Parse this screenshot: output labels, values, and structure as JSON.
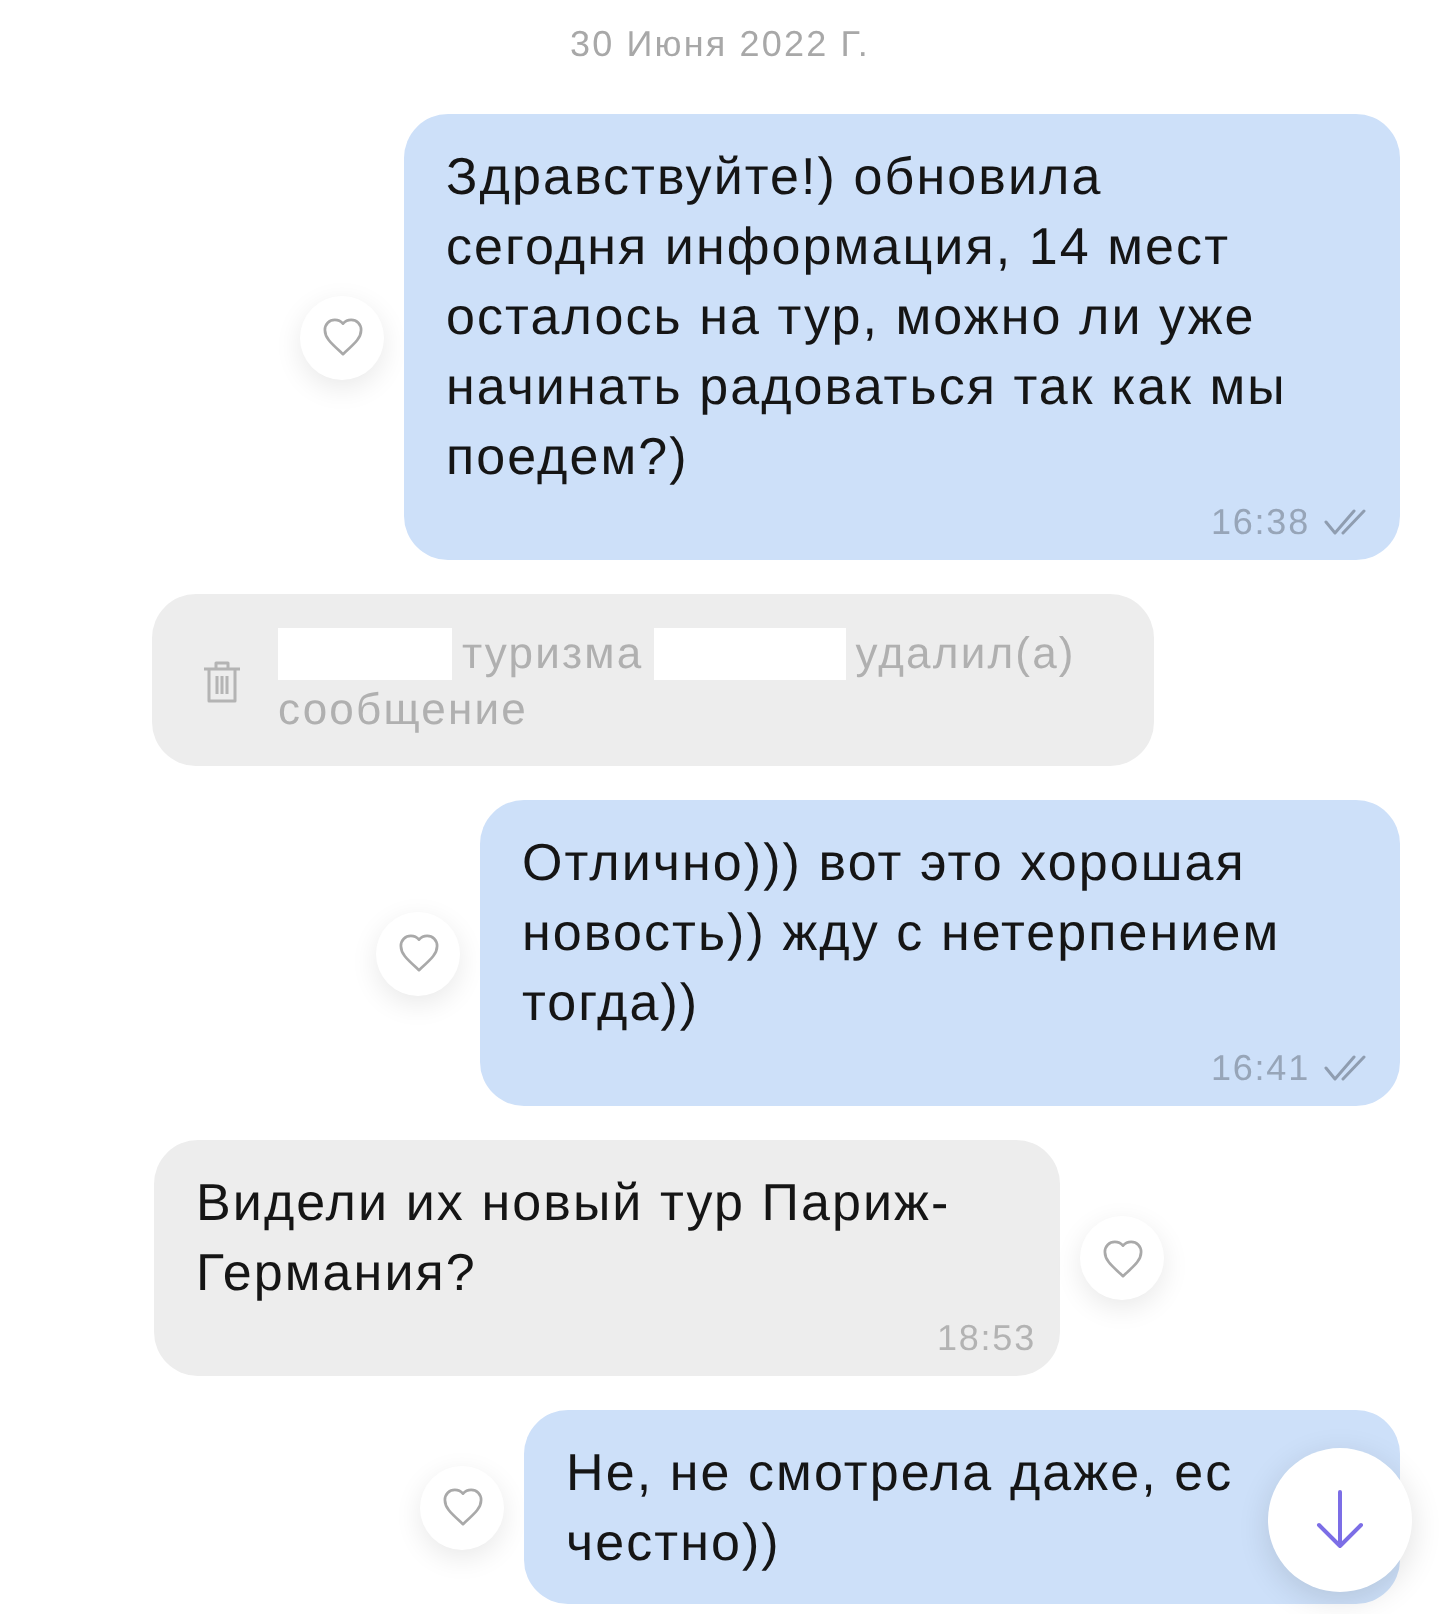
{
  "date": "30 Июня 2022 Г.",
  "messages": [
    {
      "kind": "outgoing",
      "lines": [
        "Здравствуйте!) обновила",
        "сегодня информация, 14 мест",
        "осталось на тур, можно ли уже",
        "начинать радоваться так как мы",
        "поедем?)"
      ],
      "time": "16:38",
      "read": true
    },
    {
      "kind": "deleted",
      "segments": [
        {
          "kind": "redacted"
        },
        {
          "kind": "text",
          "text": "туризма"
        },
        {
          "kind": "redacted"
        },
        {
          "kind": "text",
          "text": "удалил(а)"
        },
        {
          "kind": "text",
          "text": "сообщение"
        }
      ]
    },
    {
      "kind": "outgoing",
      "lines": [
        "Отлично))) вот это хорошая",
        "новость)) жду с нетерпением",
        "тогда))"
      ],
      "time": "16:41",
      "read": true
    },
    {
      "kind": "incoming",
      "lines": [
        "Видели их новый тур Париж-",
        "Германия?"
      ],
      "time": "18:53"
    },
    {
      "kind": "outgoing",
      "lines": [
        "Не, не смотрела даже, ес",
        "честно))"
      ]
    }
  ]
}
